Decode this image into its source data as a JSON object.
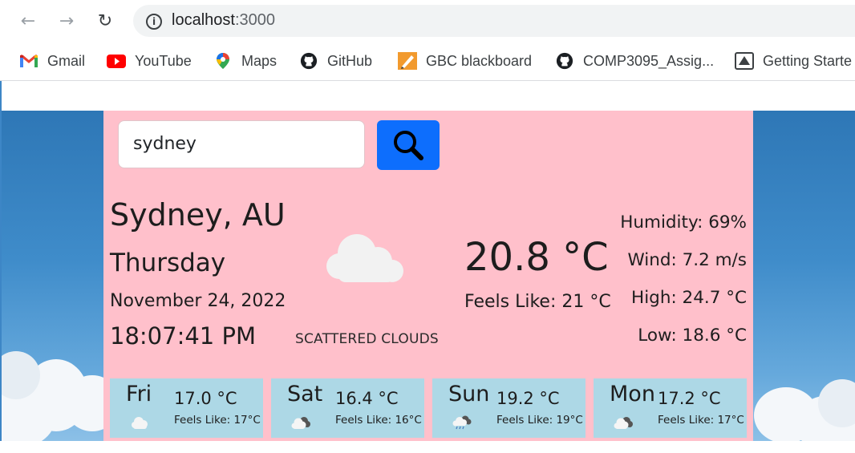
{
  "browser": {
    "url_host": "localhost",
    "url_port": ":3000",
    "bookmarks": [
      {
        "label": "Gmail",
        "icon": "gmail-icon"
      },
      {
        "label": "YouTube",
        "icon": "youtube-icon"
      },
      {
        "label": "Maps",
        "icon": "maps-icon"
      },
      {
        "label": "GitHub",
        "icon": "github-icon"
      },
      {
        "label": "GBC blackboard",
        "icon": "blackboard-icon"
      },
      {
        "label": "COMP3095_Assig...",
        "icon": "github-icon"
      },
      {
        "label": "Getting Starte",
        "icon": "getting-started-icon"
      }
    ]
  },
  "search": {
    "value": "sydney"
  },
  "current": {
    "city": "Sydney, AU",
    "day": "Thursday",
    "date": "November 24, 2022",
    "time": "18:07:41 PM",
    "description": "SCATTERED CLOUDS",
    "icon": "scattered-clouds-icon",
    "temperature": "20.8 °C",
    "feels_like": "Feels Like: 21 °C",
    "humidity": "Humidity: 69%",
    "wind": "Wind: 7.2 m/s",
    "high": "High: 24.7 °C",
    "low": "Low: 18.6 °C"
  },
  "forecast": [
    {
      "day": "Fri",
      "temp": "17.0 °C",
      "feels": "Feels Like: 17°C",
      "icon": "few-clouds-icon"
    },
    {
      "day": "Sat",
      "temp": "16.4 °C",
      "feels": "Feels Like: 16°C",
      "icon": "broken-clouds-icon"
    },
    {
      "day": "Sun",
      "temp": "19.2 °C",
      "feels": "Feels Like: 19°C",
      "icon": "rain-cloud-icon"
    },
    {
      "day": "Mon",
      "temp": "17.2 °C",
      "feels": "Feels Like: 17°C",
      "icon": "broken-clouds-icon"
    }
  ],
  "colors": {
    "card": "#ffc0cb",
    "forecast_card": "#add8e6",
    "search_button": "#0d6efd",
    "sky": "#3f8cca"
  }
}
